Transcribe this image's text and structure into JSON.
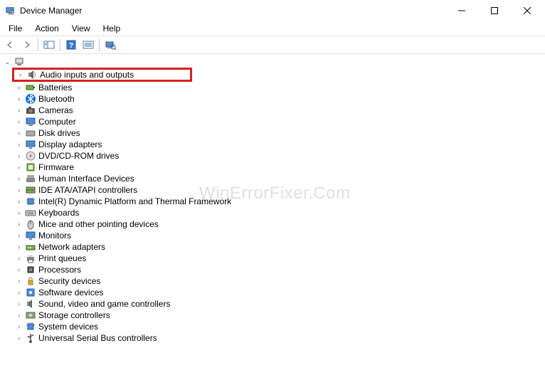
{
  "title": "Device Manager",
  "menu": [
    "File",
    "Action",
    "View",
    "Help"
  ],
  "watermark": "WinErrorFixer.Com",
  "categories": [
    {
      "label": "Audio inputs and outputs",
      "icon": "audio",
      "highlight": true
    },
    {
      "label": "Batteries",
      "icon": "battery"
    },
    {
      "label": "Bluetooth",
      "icon": "bluetooth"
    },
    {
      "label": "Cameras",
      "icon": "camera"
    },
    {
      "label": "Computer",
      "icon": "computer"
    },
    {
      "label": "Disk drives",
      "icon": "disk"
    },
    {
      "label": "Display adapters",
      "icon": "display"
    },
    {
      "label": "DVD/CD-ROM drives",
      "icon": "dvd"
    },
    {
      "label": "Firmware",
      "icon": "firmware"
    },
    {
      "label": "Human Interface Devices",
      "icon": "hid"
    },
    {
      "label": "IDE ATA/ATAPI controllers",
      "icon": "ide"
    },
    {
      "label": "Intel(R) Dynamic Platform and Thermal Framework",
      "icon": "chip"
    },
    {
      "label": "Keyboards",
      "icon": "keyboard"
    },
    {
      "label": "Mice and other pointing devices",
      "icon": "mouse"
    },
    {
      "label": "Monitors",
      "icon": "monitor"
    },
    {
      "label": "Network adapters",
      "icon": "network"
    },
    {
      "label": "Print queues",
      "icon": "printer"
    },
    {
      "label": "Processors",
      "icon": "cpu"
    },
    {
      "label": "Security devices",
      "icon": "security"
    },
    {
      "label": "Software devices",
      "icon": "software"
    },
    {
      "label": "Sound, video and game controllers",
      "icon": "sound"
    },
    {
      "label": "Storage controllers",
      "icon": "storage"
    },
    {
      "label": "System devices",
      "icon": "system"
    },
    {
      "label": "Universal Serial Bus controllers",
      "icon": "usb"
    }
  ]
}
